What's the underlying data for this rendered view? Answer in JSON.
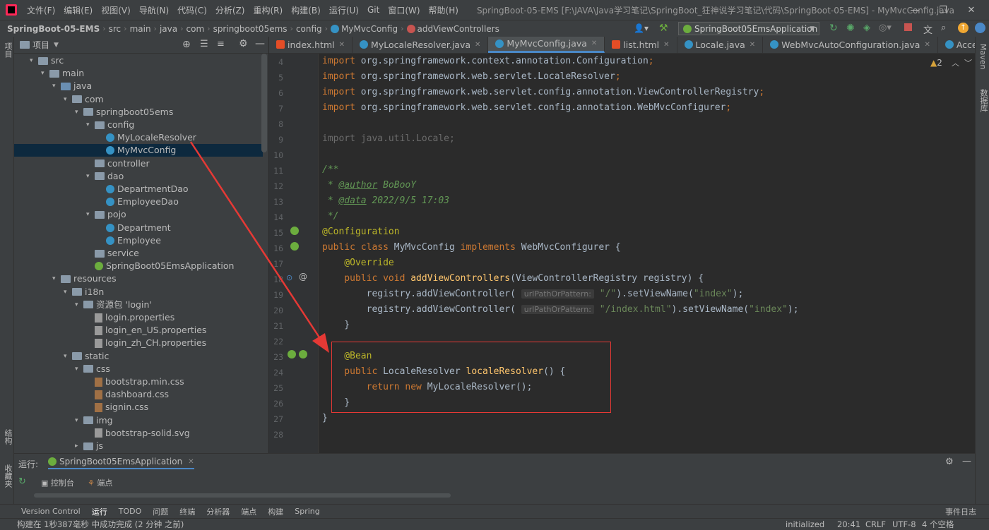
{
  "menu": {
    "items": [
      "文件(F)",
      "编辑(E)",
      "视图(V)",
      "导航(N)",
      "代码(C)",
      "分析(Z)",
      "重构(R)",
      "构建(B)",
      "运行(U)",
      "Git",
      "窗口(W)",
      "帮助(H)"
    ],
    "window_title": "SpringBoot-05-EMS [F:\\JAVA\\Java学习笔记\\SpringBoot_狂神说学习笔记\\代码\\SpringBoot-05-EMS] - MyMvcConfig.java"
  },
  "breadcrumb": {
    "items": [
      "SpringBoot-05-EMS",
      "src",
      "main",
      "java",
      "com",
      "springboot05ems",
      "config",
      "MyMvcConfig",
      "addViewControllers"
    ],
    "run_config": "SpringBoot05EmsApplication"
  },
  "left_strip": {
    "project": "项目",
    "structure": "结构",
    "favorites": "收藏夹"
  },
  "right_strip": {
    "maven": "Maven",
    "database": "数据库"
  },
  "project_panel": {
    "title": "项目",
    "tree": [
      {
        "label": "src",
        "kind": "folder",
        "depth": 2,
        "arrow": "▾"
      },
      {
        "label": "main",
        "kind": "folder",
        "depth": 3,
        "arrow": "▾"
      },
      {
        "label": "java",
        "kind": "folder-blue",
        "depth": 4,
        "arrow": "▾"
      },
      {
        "label": "com",
        "kind": "folder",
        "depth": 5,
        "arrow": "▾"
      },
      {
        "label": "springboot05ems",
        "kind": "folder",
        "depth": 6,
        "arrow": "▾"
      },
      {
        "label": "config",
        "kind": "folder",
        "depth": 7,
        "arrow": "▾"
      },
      {
        "label": "MyLocaleResolver",
        "kind": "class",
        "depth": 8,
        "arrow": ""
      },
      {
        "label": "MyMvcConfig",
        "kind": "class",
        "depth": 8,
        "arrow": "",
        "selected": true
      },
      {
        "label": "controller",
        "kind": "folder",
        "depth": 7,
        "arrow": ""
      },
      {
        "label": "dao",
        "kind": "folder",
        "depth": 7,
        "arrow": "▾"
      },
      {
        "label": "DepartmentDao",
        "kind": "class",
        "depth": 8,
        "arrow": ""
      },
      {
        "label": "EmployeeDao",
        "kind": "class",
        "depth": 8,
        "arrow": ""
      },
      {
        "label": "pojo",
        "kind": "folder",
        "depth": 7,
        "arrow": "▾"
      },
      {
        "label": "Department",
        "kind": "class",
        "depth": 8,
        "arrow": ""
      },
      {
        "label": "Employee",
        "kind": "class",
        "depth": 8,
        "arrow": ""
      },
      {
        "label": "service",
        "kind": "folder",
        "depth": 7,
        "arrow": ""
      },
      {
        "label": "SpringBoot05EmsApplication",
        "kind": "spring",
        "depth": 7,
        "arrow": ""
      },
      {
        "label": "resources",
        "kind": "folder",
        "depth": 4,
        "arrow": "▾"
      },
      {
        "label": "i18n",
        "kind": "folder",
        "depth": 5,
        "arrow": "▾"
      },
      {
        "label": "资源包 'login'",
        "kind": "folder",
        "depth": 6,
        "arrow": "▾"
      },
      {
        "label": "login.properties",
        "kind": "file",
        "depth": 7,
        "arrow": ""
      },
      {
        "label": "login_en_US.properties",
        "kind": "file",
        "depth": 7,
        "arrow": ""
      },
      {
        "label": "login_zh_CH.properties",
        "kind": "file",
        "depth": 7,
        "arrow": ""
      },
      {
        "label": "static",
        "kind": "folder",
        "depth": 5,
        "arrow": "▾"
      },
      {
        "label": "css",
        "kind": "folder",
        "depth": 6,
        "arrow": "▾"
      },
      {
        "label": "bootstrap.min.css",
        "kind": "css",
        "depth": 7,
        "arrow": ""
      },
      {
        "label": "dashboard.css",
        "kind": "css",
        "depth": 7,
        "arrow": ""
      },
      {
        "label": "signin.css",
        "kind": "css",
        "depth": 7,
        "arrow": ""
      },
      {
        "label": "img",
        "kind": "folder",
        "depth": 6,
        "arrow": "▾"
      },
      {
        "label": "bootstrap-solid.svg",
        "kind": "file",
        "depth": 7,
        "arrow": ""
      },
      {
        "label": "js",
        "kind": "folder",
        "depth": 6,
        "arrow": "▸"
      }
    ]
  },
  "editor_tabs": [
    {
      "label": "index.html",
      "kind": "html",
      "active": false
    },
    {
      "label": "MyLocaleResolver.java",
      "kind": "class",
      "active": false
    },
    {
      "label": "MyMvcConfig.java",
      "kind": "class",
      "active": true
    },
    {
      "label": "list.html",
      "kind": "html",
      "active": false
    },
    {
      "label": "Locale.java",
      "kind": "class",
      "active": false
    },
    {
      "label": "WebMvcAutoConfiguration.java",
      "kind": "class",
      "active": false
    },
    {
      "label": "AcceptHeaderLocaleRe",
      "kind": "class",
      "active": false
    }
  ],
  "editor": {
    "warnings": "2",
    "line_numbers": [
      "4",
      "5",
      "6",
      "7",
      "8",
      "9",
      "10",
      "11",
      "12",
      "13",
      "14",
      "15",
      "16",
      "17",
      "18",
      "19",
      "20",
      "21",
      "22",
      "23",
      "24",
      "25",
      "26",
      "27",
      "28"
    ],
    "lines": {
      "l4": [
        "import ",
        "org.springframework.context.annotation.Configuration",
        ";"
      ],
      "l5": [
        "import ",
        "org.springframework.web.servlet.LocaleResolver",
        ";"
      ],
      "l6": [
        "import ",
        "org.springframework.web.servlet.config.annotation.ViewControllerRegistry",
        ";"
      ],
      "l7": [
        "import ",
        "org.springframework.web.servlet.config.annotation.WebMvcConfigurer",
        ";"
      ],
      "l9": "import java.util.Locale;",
      "l11": "/**",
      "l12": [
        " * ",
        "@author",
        " BoBooY"
      ],
      "l13": [
        " * ",
        "@data",
        " 2022/9/5 17:03"
      ],
      "l14": " */",
      "l15": "@Configuration",
      "l16": [
        "public class ",
        "MyMvcConfig ",
        "implements ",
        "WebMvcConfigurer {"
      ],
      "l17": "    @Override",
      "l18": [
        "    public void ",
        "addViewControllers",
        "(ViewControllerRegistry registry) {"
      ],
      "l19": [
        "        registry.addViewController(",
        "urlPathOrPattern:",
        "\"/\"",
        ").setViewName(",
        "\"index\"",
        ");"
      ],
      "l20": [
        "        registry.addViewController(",
        "urlPathOrPattern:",
        "\"/index.html\"",
        ").setViewName(",
        "\"index\"",
        ");"
      ],
      "l21": "    }",
      "l23": "    @Bean",
      "l24": [
        "    public ",
        "LocaleResolver ",
        "localeResolver",
        "() {"
      ],
      "l25": [
        "        return new ",
        "MyLocaleResolver();"
      ],
      "l26": "    }",
      "l27": "}"
    }
  },
  "run_panel": {
    "label": "运行:",
    "config": "SpringBoot05EmsApplication",
    "tabs": [
      "控制台",
      "端点"
    ]
  },
  "tool_strip": [
    "Version Control",
    "运行",
    "TODO",
    "问题",
    "终端",
    "分析器",
    "端点",
    "构建",
    "Spring",
    "事件日志"
  ],
  "status": {
    "message": "构建在 1秒387毫秒 中成功完成 (2 分钟 之前)",
    "state": "initialized",
    "position": "20:41",
    "line_sep": "CRLF",
    "encoding": "UTF-8",
    "indent": "4 个空格"
  },
  "colors": {
    "accent": "#4a88c7",
    "annotation_box": "#e53935",
    "keyword": "#cc7832",
    "string": "#6a8759"
  }
}
